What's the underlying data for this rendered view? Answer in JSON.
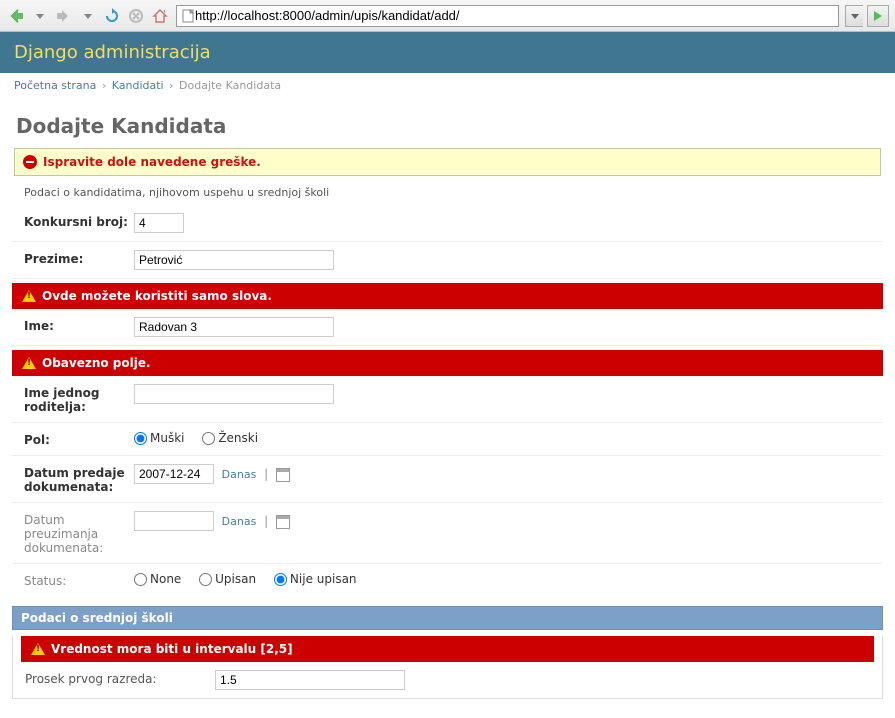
{
  "browser": {
    "url": "http://localhost:8000/admin/upis/kandidat/add/"
  },
  "header": {
    "title": "Django administracija"
  },
  "breadcrumbs": {
    "home": "Početna strana",
    "model": "Kandidati",
    "current": "Dodajte Kandidata"
  },
  "page_title": "Dodajte Kandidata",
  "error_note": "Ispravite dole navedene greške.",
  "help_text": "Podaci o kandidatima, njihovom uspehu u srednjoj školi",
  "fields": {
    "konkursni_broj": {
      "label": "Konkursni broj:",
      "value": "4"
    },
    "prezime": {
      "label": "Prezime:",
      "value": "Petrović"
    },
    "ime_error": "Ovde možete koristiti samo slova.",
    "ime": {
      "label": "Ime:",
      "value": "Radovan 3"
    },
    "roditelj_error": "Obavezno polje.",
    "roditelj": {
      "label": "Ime jednog roditelja:",
      "value": ""
    },
    "pol": {
      "label": "Pol:",
      "opt1": "Muški",
      "opt2": "Ženski"
    },
    "datum_predaje": {
      "label": "Datum predaje dokumenata:",
      "value": "2007-12-24",
      "today": "Danas"
    },
    "datum_preuz": {
      "label": "Datum preuzimanja dokumenata:",
      "value": "",
      "today": "Danas"
    },
    "status": {
      "label": "Status:",
      "opt1": "None",
      "opt2": "Upisan",
      "opt3": "Nije upisan"
    }
  },
  "section2": {
    "title": "Podaci o srednjoj školi",
    "prosek_err": "Vrednost mora biti u intervalu [2,5]",
    "prosek1": {
      "label": "Prosek prvog razreda:",
      "value": "1.5"
    }
  }
}
